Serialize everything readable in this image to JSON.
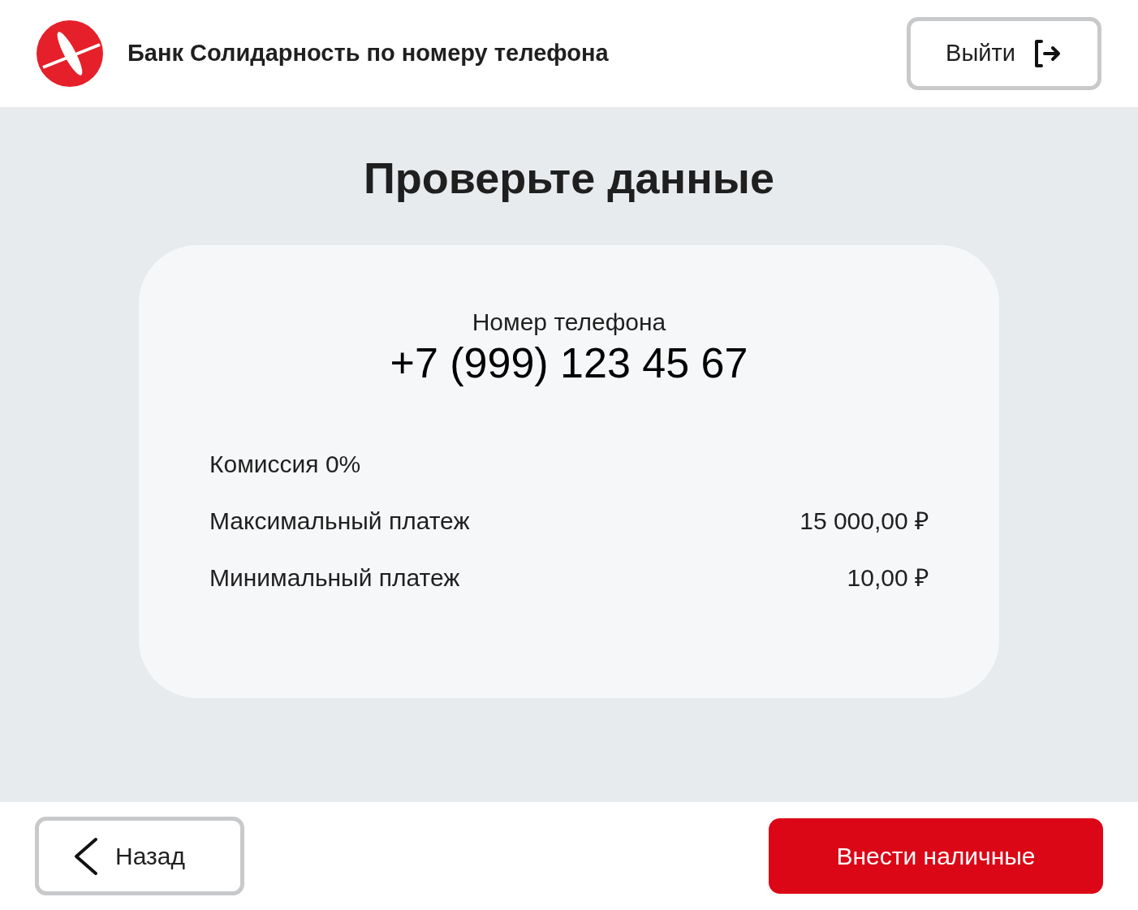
{
  "header": {
    "title": "Банк Солидарность по номеру телефона",
    "exit_button": "Выйти"
  },
  "heading": "Проверьте данные",
  "card": {
    "phone_label": "Номер телефона",
    "phone": "+7 (999) 123 45 67",
    "rows": [
      {
        "label": "Комиссия 0%"
      },
      {
        "label": "Максимальный платеж",
        "value": "15 000,00 ₽"
      },
      {
        "label": "Минимальный платеж",
        "value": "10,00 ₽"
      }
    ]
  },
  "footer": {
    "back_button": "Назад",
    "submit_button": "Внести наличные"
  }
}
